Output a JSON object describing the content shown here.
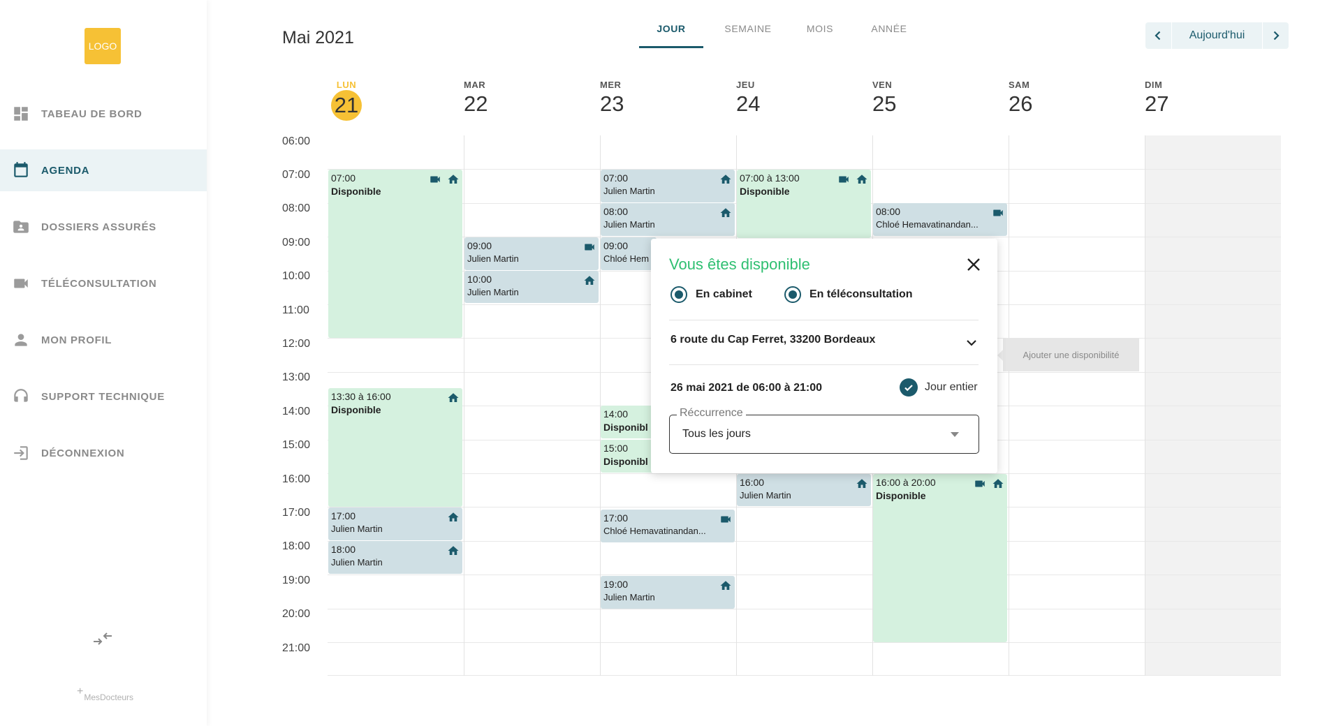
{
  "sidebar": {
    "logo": "LOGO",
    "items": [
      {
        "label": "TABEAU DE BORD",
        "icon": "dashboard-icon"
      },
      {
        "label": "AGENDA",
        "icon": "calendar-icon",
        "active": true
      },
      {
        "label": "DOSSIERS ASSURÉS",
        "icon": "folder-user-icon"
      },
      {
        "label": "TÉLÉCONSULTATION",
        "icon": "video-camera-icon"
      },
      {
        "label": "MON PROFIL",
        "icon": "person-icon"
      },
      {
        "label": "SUPPORT TECHNIQUE",
        "icon": "headset-icon"
      },
      {
        "label": "DÉCONNEXION",
        "icon": "logout-icon"
      }
    ],
    "brand": "MesDocteurs"
  },
  "header": {
    "title": "Mai 2021",
    "tabs": [
      {
        "label": "JOUR",
        "active": true
      },
      {
        "label": "SEMAINE"
      },
      {
        "label": "MOIS"
      },
      {
        "label": "ANNÉE"
      }
    ],
    "today_label": "Aujourd'hui"
  },
  "days": [
    {
      "name": "LUN",
      "num": "21",
      "today": true
    },
    {
      "name": "MAR",
      "num": "22"
    },
    {
      "name": "MER",
      "num": "23"
    },
    {
      "name": "JEU",
      "num": "24"
    },
    {
      "name": "VEN",
      "num": "25"
    },
    {
      "name": "SAM",
      "num": "26"
    },
    {
      "name": "DIM",
      "num": "27"
    }
  ],
  "hours": [
    "06:00",
    "07:00",
    "08:00",
    "09:00",
    "10:00",
    "11:00",
    "12:00",
    "13:00",
    "14:00",
    "15:00",
    "16:00",
    "17:00",
    "18:00",
    "19:00",
    "20:00",
    "21:00"
  ],
  "events": {
    "e1": {
      "time": "07:00",
      "name": "Disponible"
    },
    "e2": {
      "time": "13:30 à 16:00",
      "name": "Disponible"
    },
    "e3": {
      "time": "17:00",
      "name": "Julien Martin"
    },
    "e4": {
      "time": "18:00",
      "name": "Julien Martin"
    },
    "e5": {
      "time": "09:00",
      "name": "Julien Martin"
    },
    "e6": {
      "time": "10:00",
      "name": "Julien Martin"
    },
    "e7": {
      "time": "07:00",
      "name": "Julien Martin"
    },
    "e8": {
      "time": "08:00",
      "name": "Julien Martin"
    },
    "e9": {
      "time": "09:00",
      "name": "Chloé Hem"
    },
    "e10": {
      "time": "14:00",
      "name": "Disponibl"
    },
    "e11": {
      "time": "15:00",
      "name": "Disponibl"
    },
    "e12": {
      "time": "17:00",
      "name": "Chloé Hemavatinandan..."
    },
    "e13": {
      "time": "19:00",
      "name": "Julien Martin"
    },
    "e14": {
      "time": "07:00 à 13:00",
      "name": "Disponible"
    },
    "e15": {
      "time": "16:00",
      "name": "Julien Martin"
    },
    "e16": {
      "time": "08:00",
      "name": "Chloé Hemavatinandan..."
    },
    "e17": {
      "time": "16:00 à 20:00",
      "name": "Disponible"
    }
  },
  "popup": {
    "title": "Vous êtes disponible",
    "option_cabinet": "En cabinet",
    "option_tele": "En téléconsultation",
    "address": "6 route du Cap Ferret, 33200 Bordeaux",
    "date_range": "26 mai 2021 de 06:00 à 21:00",
    "all_day": "Jour entier",
    "recurrence_label": "Réccurrence",
    "recurrence_value": "Tous les jours"
  },
  "add_slot": "Ajouter une disponibilité",
  "colors": {
    "primary": "#1b5a6b",
    "accent": "#f6c135",
    "available": "#d5f1df",
    "appointment": "#cfdfe4",
    "popup_title": "#2fbf71"
  }
}
